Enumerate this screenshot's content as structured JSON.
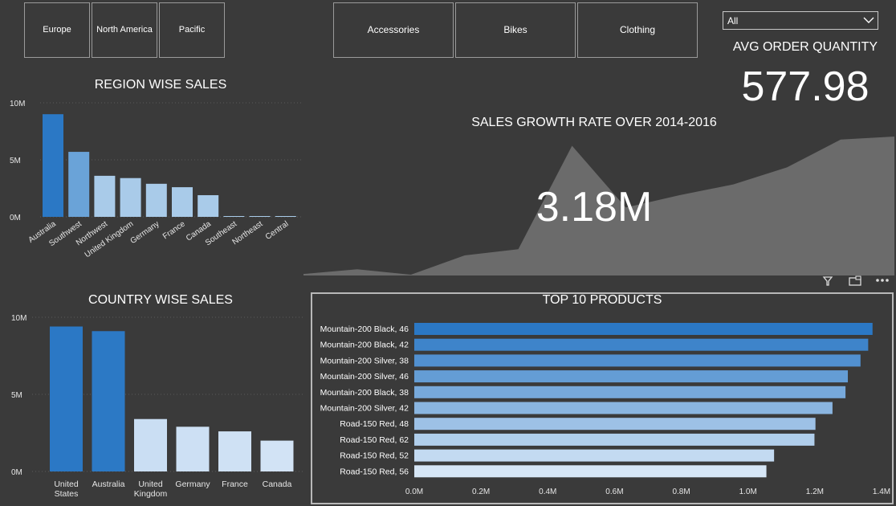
{
  "region_slicer": {
    "items": [
      "Europe",
      "North America",
      "Pacific"
    ]
  },
  "category_slicer": {
    "items": [
      "Accessories",
      "Bikes",
      "Clothing"
    ]
  },
  "dropdown": {
    "selected": "All"
  },
  "avg_order": {
    "title": "AVG ORDER QUANTITY",
    "value": "577.98"
  },
  "growth": {
    "title": "SALES GROWTH RATE OVER 2014-2016",
    "value": "3.18M"
  },
  "colors": {
    "background": "#3a3a3a",
    "bar_dark": "#2b78c5",
    "bar_light": "#a9cbe9",
    "area": "#6b6b6b"
  },
  "chart_data": [
    {
      "id": "region",
      "type": "bar",
      "title": "REGION WISE SALES",
      "categories": [
        "Australia",
        "Southwest",
        "Northwest",
        "United Kingdom",
        "Germany",
        "France",
        "Canada",
        "Southeast",
        "Northeast",
        "Central"
      ],
      "values": [
        9.0,
        5.7,
        3.6,
        3.4,
        2.9,
        2.6,
        1.9,
        0.01,
        0.01,
        0.01
      ],
      "unit": "M",
      "yticks": [
        "0M",
        "5M",
        "10M"
      ],
      "ylim": [
        0,
        10
      ],
      "grid": true
    },
    {
      "id": "country",
      "type": "bar",
      "title": "COUNTRY WISE SALES",
      "categories": [
        "United States",
        "Australia",
        "United Kingdom",
        "Germany",
        "France",
        "Canada"
      ],
      "values": [
        9.4,
        9.1,
        3.4,
        2.9,
        2.6,
        2.0
      ],
      "unit": "M",
      "yticks": [
        "0M",
        "5M",
        "10M"
      ],
      "ylim": [
        0,
        10
      ],
      "grid": true
    },
    {
      "id": "growth",
      "type": "area",
      "title": "SALES GROWTH RATE OVER 2014-2016",
      "values": [
        0.1,
        0.4,
        0.05,
        1.3,
        1.7,
        8.4,
        4.4,
        5.2,
        5.9,
        7.0,
        8.8,
        9.0
      ]
    },
    {
      "id": "top10",
      "type": "bar",
      "orientation": "horizontal",
      "title": "TOP 10 PRODUCTS",
      "categories": [
        "Mountain-200 Black, 46",
        "Mountain-200 Black, 42",
        "Mountain-200 Silver, 38",
        "Mountain-200 Silver, 46",
        "Mountain-200 Black, 38",
        "Mountain-200 Silver, 42",
        "Road-150 Red, 48",
        "Road-150 Red, 62",
        "Road-150 Red, 52",
        "Road-150 Red, 56"
      ],
      "values": [
        1.373,
        1.36,
        1.337,
        1.299,
        1.292,
        1.253,
        1.202,
        1.199,
        1.078,
        1.055
      ],
      "unit": "M",
      "xticks": [
        "0.0M",
        "0.2M",
        "0.4M",
        "0.6M",
        "0.8M",
        "1.0M",
        "1.2M",
        "1.4M"
      ],
      "xlim": [
        0,
        1.4
      ]
    }
  ]
}
